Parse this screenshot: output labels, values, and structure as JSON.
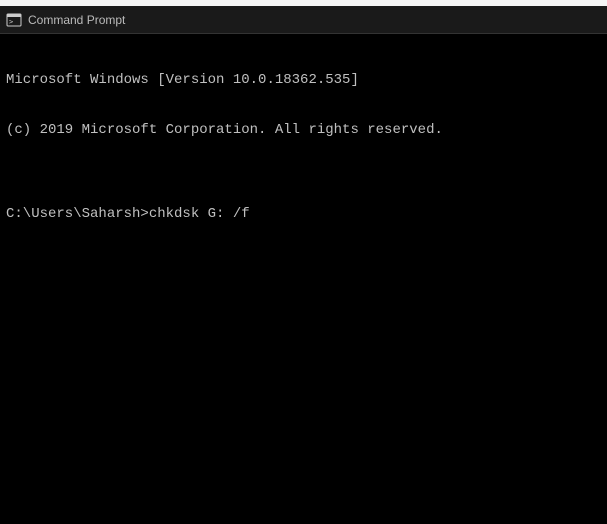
{
  "window": {
    "title": "Command Prompt"
  },
  "terminal": {
    "line1": "Microsoft Windows [Version 10.0.18362.535]",
    "line2": "(c) 2019 Microsoft Corporation. All rights reserved.",
    "blank": "",
    "prompt": "C:\\Users\\Saharsh>",
    "command": "chkdsk G: /f"
  }
}
